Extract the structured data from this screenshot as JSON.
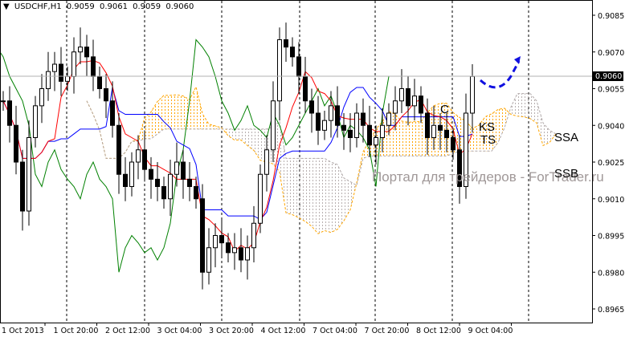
{
  "header": {
    "symbol": "USDCHF,H1",
    "open": "0.9059",
    "high": "0.9061",
    "low": "0.9059",
    "close": "0.9060"
  },
  "watermark": "Портал для трейдеров - ForTrader.ru",
  "current_price_label": "0.9060",
  "annotations": {
    "c": "C",
    "ks": "KS",
    "ts": "TS",
    "ssa": "SSA",
    "ssb": "SSB"
  },
  "colors": {
    "tenkan": "#ff0000",
    "kijun": "#0000ff",
    "chikou": "#008000",
    "ssa": "#ffa500",
    "ssb": "#b0a8a8",
    "arrow": "#1010e0"
  },
  "chart_data": {
    "type": "candlestick",
    "title": "USDCHF,H1",
    "ylim": [
      0.8958,
      0.9093
    ],
    "yticks": [
      "0.9085",
      "0.9070",
      "0.9055",
      "0.9040",
      "0.9025",
      "0.9010",
      "0.8995",
      "0.8980",
      "0.8965"
    ],
    "xticks": [
      "1 Oct 2013",
      "1 Oct 20:00",
      "2 Oct 12:00",
      "3 Oct 04:00",
      "3 Oct 20:00",
      "4 Oct 12:00",
      "7 Oct 04:00",
      "7 Oct 20:00",
      "8 Oct 12:00",
      "9 Oct 04:00"
    ],
    "indicator": "Ichimoku Kinko Hyo",
    "closes": [
      0.905,
      0.904,
      0.9025,
      0.9005,
      0.9035,
      0.9048,
      0.9055,
      0.9062,
      0.9065,
      0.9058,
      0.906,
      0.907,
      0.9072,
      0.9068,
      0.906,
      0.9055,
      0.905,
      0.904,
      0.902,
      0.9015,
      0.9025,
      0.903,
      0.9022,
      0.9018,
      0.9015,
      0.901,
      0.902,
      0.9025,
      0.9018,
      0.9015,
      0.901,
      0.898,
      0.899,
      0.8995,
      0.8992,
      0.8988,
      0.899,
      0.8985,
      0.899,
      0.9,
      0.902,
      0.903,
      0.905,
      0.9075,
      0.9072,
      0.9068,
      0.906,
      0.905,
      0.9045,
      0.9038,
      0.9042,
      0.9048,
      0.904,
      0.9038,
      0.9035,
      0.9045,
      0.904,
      0.9032,
      0.9035,
      0.904,
      0.9045,
      0.905,
      0.9055,
      0.9048,
      0.9052,
      0.9045,
      0.9035,
      0.904,
      0.9038,
      0.9035,
      0.903,
      0.9015,
      0.9045,
      0.906
    ]
  }
}
